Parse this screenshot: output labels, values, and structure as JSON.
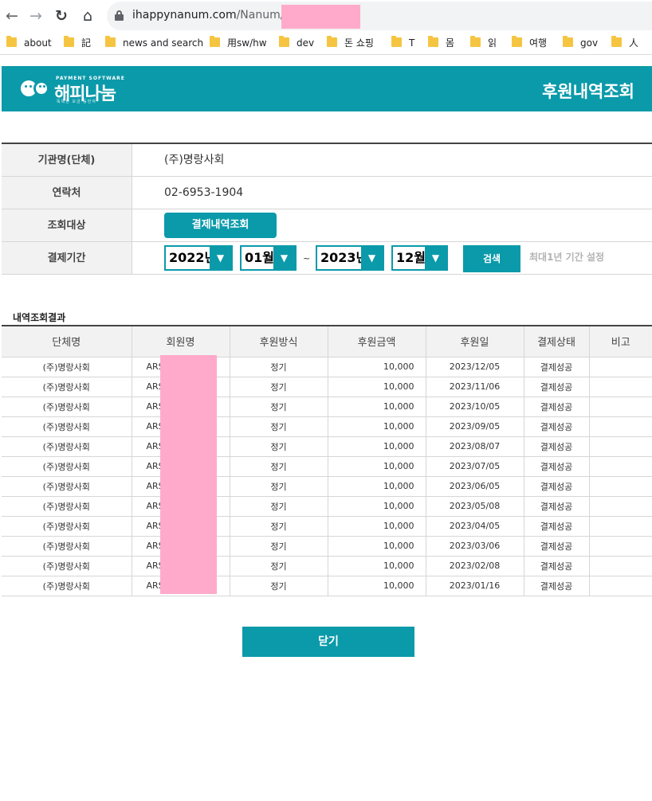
{
  "browser": {
    "url_domain": "ihappynanum.com",
    "url_path": "/Nanum/P/",
    "bookmarks": [
      "about",
      "記",
      "news and search",
      "用sw/hw",
      "dev",
      "돈 쇼핑",
      "T",
      "몸",
      "읽",
      "여행",
      "gov",
      "人"
    ]
  },
  "header": {
    "logo_tagline": "PAYMENT SOFTWARE",
    "logo_name": "해피나눔",
    "logo_subtext": "똑똑한 모금 동반자",
    "page_title": "후원내역조회"
  },
  "info": {
    "org_label": "기관명(단체)",
    "org_value": "(주)명랑사회",
    "contact_label": "연락처",
    "contact_value": "02-6953-1904",
    "target_label": "조회대상",
    "target_button": "결제내역조회",
    "period_label": "결제기간",
    "start_year": "2022년",
    "start_month": "01월",
    "end_year": "2023년",
    "end_month": "12월",
    "separator": "~",
    "search_button": "검색",
    "hint": "최대1년 기간 설정"
  },
  "results": {
    "title": "내역조회결과",
    "columns": [
      "단체명",
      "회원명",
      "후원방식",
      "후원금액",
      "후원일",
      "결제상태",
      "비고"
    ],
    "rows": [
      {
        "org": "(주)명랑사회",
        "member": "ARS",
        "method": "정기",
        "amount": "10,000",
        "date": "2023/12/05",
        "status": "결제성공",
        "note": ""
      },
      {
        "org": "(주)명랑사회",
        "member": "ARS",
        "method": "정기",
        "amount": "10,000",
        "date": "2023/11/06",
        "status": "결제성공",
        "note": ""
      },
      {
        "org": "(주)명랑사회",
        "member": "ARS",
        "method": "정기",
        "amount": "10,000",
        "date": "2023/10/05",
        "status": "결제성공",
        "note": ""
      },
      {
        "org": "(주)명랑사회",
        "member": "ARS",
        "method": "정기",
        "amount": "10,000",
        "date": "2023/09/05",
        "status": "결제성공",
        "note": ""
      },
      {
        "org": "(주)명랑사회",
        "member": "ARS",
        "method": "정기",
        "amount": "10,000",
        "date": "2023/08/07",
        "status": "결제성공",
        "note": ""
      },
      {
        "org": "(주)명랑사회",
        "member": "ARS",
        "method": "정기",
        "amount": "10,000",
        "date": "2023/07/05",
        "status": "결제성공",
        "note": ""
      },
      {
        "org": "(주)명랑사회",
        "member": "ARS",
        "method": "정기",
        "amount": "10,000",
        "date": "2023/06/05",
        "status": "결제성공",
        "note": ""
      },
      {
        "org": "(주)명랑사회",
        "member": "ARS",
        "method": "정기",
        "amount": "10,000",
        "date": "2023/05/08",
        "status": "결제성공",
        "note": ""
      },
      {
        "org": "(주)명랑사회",
        "member": "ARS",
        "method": "정기",
        "amount": "10,000",
        "date": "2023/04/05",
        "status": "결제성공",
        "note": ""
      },
      {
        "org": "(주)명랑사회",
        "member": "ARS",
        "method": "정기",
        "amount": "10,000",
        "date": "2023/03/06",
        "status": "결제성공",
        "note": ""
      },
      {
        "org": "(주)명랑사회",
        "member": "ARS",
        "method": "정기",
        "amount": "10,000",
        "date": "2023/02/08",
        "status": "결제성공",
        "note": ""
      },
      {
        "org": "(주)명랑사회",
        "member": "ARS",
        "method": "정기",
        "amount": "10,000",
        "date": "2023/01/16",
        "status": "결제성공",
        "note": ""
      }
    ]
  },
  "footer": {
    "close_button": "닫기"
  },
  "colors": {
    "brand_teal": "#0b9aaa",
    "redaction_pink": "#ffaacb",
    "hint_gray": "#b3b3b3"
  }
}
